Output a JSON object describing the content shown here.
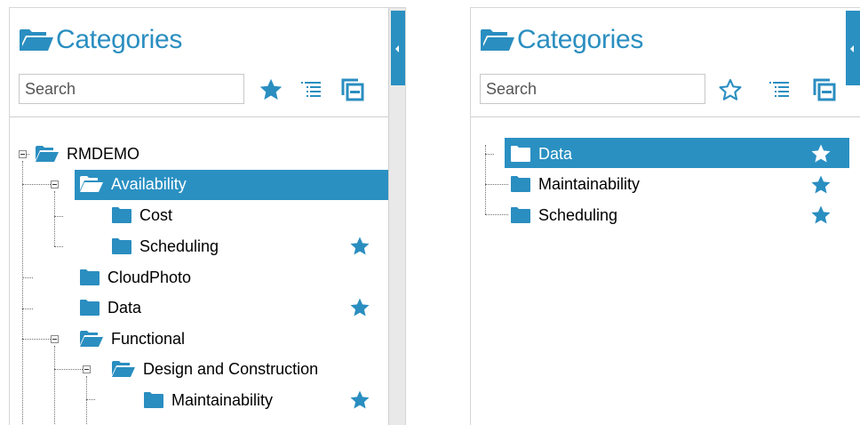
{
  "colors": {
    "accent": "#2a90c2",
    "selected_bg": "#2a90c2"
  },
  "left_panel": {
    "title": "Categories",
    "search": {
      "placeholder": "Search",
      "value": ""
    },
    "toolbar": {
      "favorites_filter": "star-filled-icon",
      "expand_all": "tree-list-icon",
      "collapse_all": "collapse-windows-icon"
    },
    "tree": {
      "root": "RMDEMO",
      "availability": "Availability",
      "cost": "Cost",
      "scheduling": "Scheduling",
      "cloudphoto": "CloudPhoto",
      "data": "Data",
      "functional": "Functional",
      "design": "Design and Construction",
      "maintainability": "Maintainability"
    }
  },
  "right_panel": {
    "title": "Categories",
    "search": {
      "placeholder": "Search",
      "value": ""
    },
    "toolbar": {
      "favorites_filter": "star-outline-icon",
      "expand_all": "tree-list-icon",
      "collapse_all": "collapse-windows-icon"
    },
    "favorites": [
      "Data",
      "Maintainability",
      "Scheduling"
    ]
  }
}
